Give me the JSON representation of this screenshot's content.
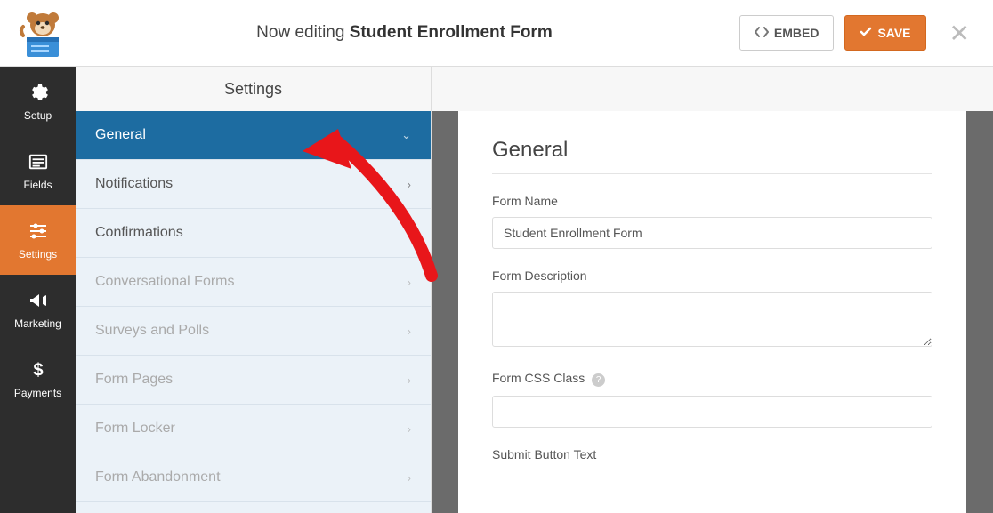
{
  "header": {
    "editing_prefix": "Now editing",
    "form_name": "Student Enrollment Form",
    "embed_label": "EMBED",
    "save_label": "SAVE"
  },
  "iconrail": {
    "setup": "Setup",
    "fields": "Fields",
    "settings": "Settings",
    "marketing": "Marketing",
    "payments": "Payments"
  },
  "mid": {
    "title": "Settings",
    "items": {
      "general": "General",
      "notifications": "Notifications",
      "confirmations": "Confirmations",
      "conversational": "Conversational Forms",
      "surveys": "Surveys and Polls",
      "formpages": "Form Pages",
      "formlocker": "Form Locker",
      "abandonment": "Form Abandonment"
    }
  },
  "content": {
    "heading": "General",
    "form_name_label": "Form Name",
    "form_name_value": "Student Enrollment Form",
    "form_desc_label": "Form Description",
    "form_desc_value": "",
    "css_class_label": "Form CSS Class",
    "css_class_value": "",
    "submit_btn_label": "Submit Button Text"
  }
}
